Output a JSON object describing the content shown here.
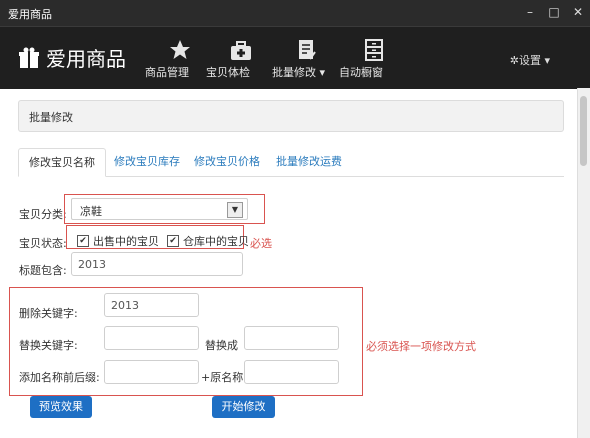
{
  "window": {
    "title": "爱用商品",
    "min": "–",
    "max": "□",
    "close": "✕"
  },
  "nav": {
    "brand": "爱用商品",
    "items": [
      {
        "label": "商品管理"
      },
      {
        "label": "宝贝体检"
      },
      {
        "label": "批量修改 ▾"
      },
      {
        "label": "自动橱窗"
      }
    ],
    "settings": "✲设置 ▾"
  },
  "panel": {
    "title": "批量修改"
  },
  "tabs": [
    {
      "label": "修改宝贝名称"
    },
    {
      "label": "修改宝贝库存"
    },
    {
      "label": "修改宝贝价格"
    },
    {
      "label": "批量修改运费"
    }
  ],
  "form": {
    "category_label": "宝贝分类:",
    "category_value": "凉鞋",
    "status_label": "宝贝状态:",
    "status_options": [
      {
        "label": "出售中的宝贝",
        "checked": true
      },
      {
        "label": "仓库中的宝贝",
        "checked": true
      }
    ],
    "required_note": "必选",
    "title_contains_label": "标题包含:",
    "title_contains_value": "2013",
    "delete_keyword_label": "删除关键字:",
    "delete_keyword_value": "2013",
    "replace_keyword_label": "替换关键字:",
    "replace_keyword_value": "",
    "replace_with_label": "替换成",
    "replace_with_value": "",
    "prefix_label": "添加名称前后缀:",
    "prefix_value": "",
    "original_name_label": "+原名称+",
    "suffix_value": "",
    "choose_note": "必须选择一项修改方式"
  },
  "buttons": {
    "preview": "预览效果",
    "start": "开始修改"
  },
  "colors": {
    "accent": "#1e6fc4",
    "highlight": "#d9534f",
    "navbar": "#1f1f1f"
  }
}
